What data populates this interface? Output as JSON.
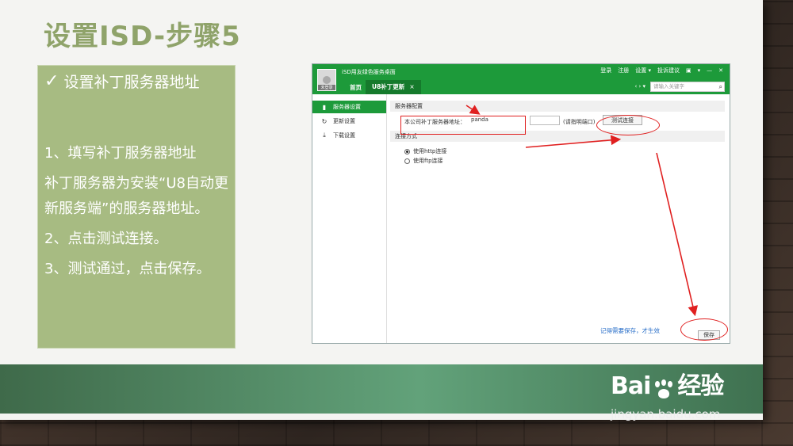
{
  "slide": {
    "title": "设置ISD-步骤5",
    "panel_heading": "设置补丁服务器地址",
    "steps": [
      "1、填写补丁服务器地址",
      "补丁服务器为安装“U8自动更新服务端”的服务器地址。",
      "2、点击测试连接。",
      "3、测试通过，点击保存。"
    ]
  },
  "app": {
    "app_name": "iSD用友绿色服务桌面",
    "avatar_label": "未登录",
    "tab_home": "首页",
    "tab_active": "U8补丁更新",
    "tab_close": "×",
    "top_links": [
      "登录",
      "注册",
      "设置 ▾",
      "投诉建议",
      "▣",
      "▾",
      "—",
      "✕"
    ],
    "nav_arrows": "‹ › ▾",
    "search_placeholder": "请输入关键字",
    "sidebar": [
      {
        "label": "服务器设置",
        "icon": "phone-icon"
      },
      {
        "label": "更新设置",
        "icon": "refresh-icon"
      },
      {
        "label": "下载设置",
        "icon": "download-icon"
      }
    ],
    "server_section_title": "服务器配置",
    "addr_label": "本公司补丁服务器地址：",
    "addr_value": "panda",
    "port_hint": "(请指明端口)",
    "test_button": "测试连接",
    "conn_section_title": "连接方式",
    "radio_options": [
      "使用http连接",
      "使用ftp连接"
    ],
    "radio_selected": 0,
    "save_hint": "记得需要保存，才生效",
    "save_button": "保存"
  },
  "watermark": {
    "logo_left": "Bai",
    "logo_right": "经验",
    "url": "jingyan.baidu.com"
  },
  "colors": {
    "title_green": "#8fa36a",
    "panel_green": "#a7bb82",
    "app_green": "#1d9a3a",
    "annotation_red": "#e02020"
  }
}
